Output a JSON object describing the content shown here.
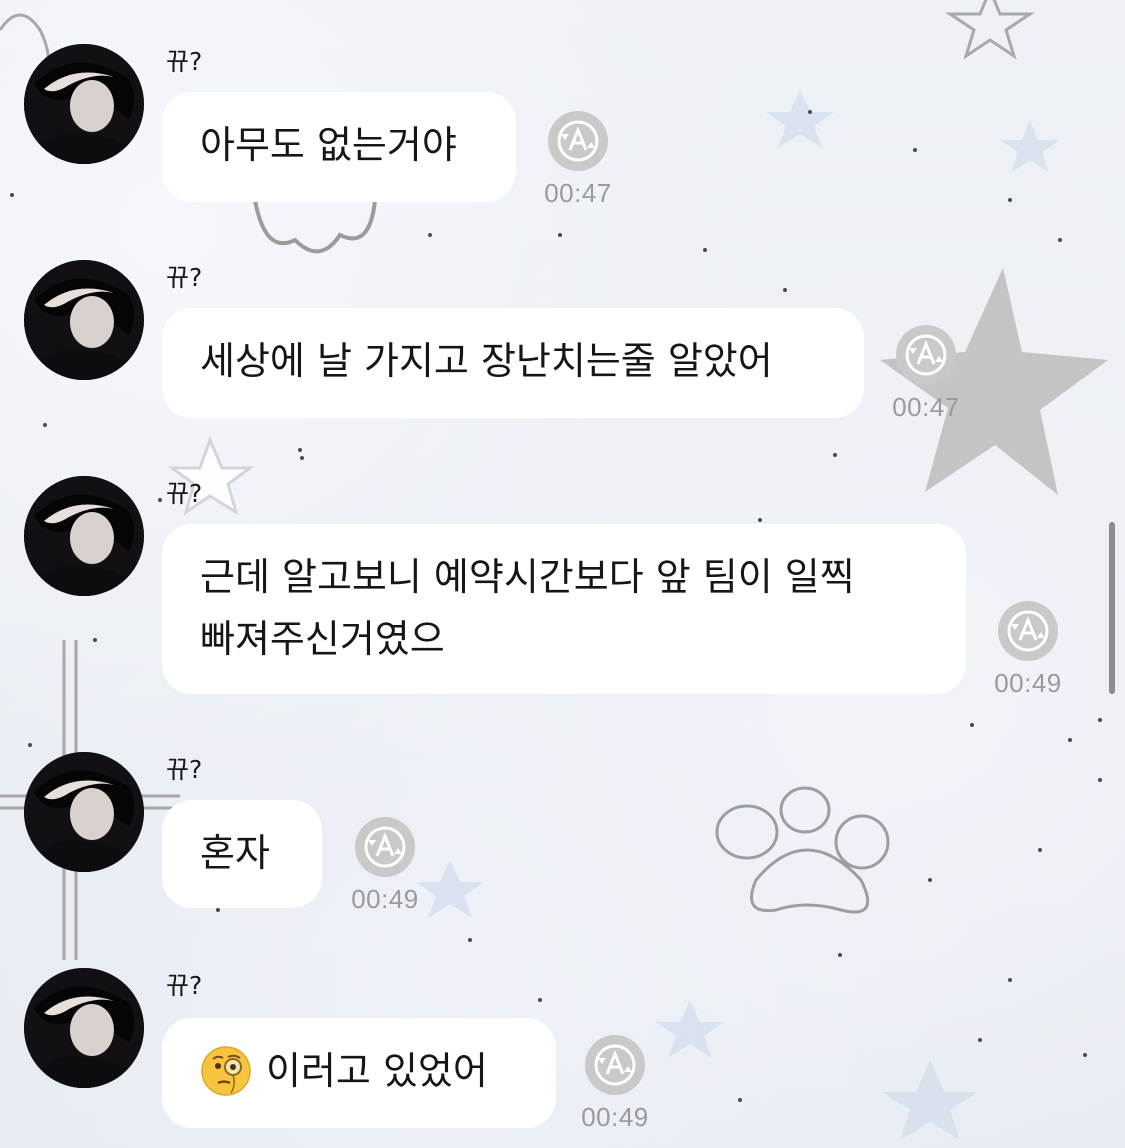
{
  "sender_name": "뀨?",
  "messages": [
    {
      "lines": [
        "아무도 없는거야"
      ],
      "time": "00:47",
      "icon": "translate-icon"
    },
    {
      "lines": [
        "세상에 날 가지고 장난치는줄 알았어"
      ],
      "time": "00:47",
      "icon": "translate-icon"
    },
    {
      "lines": [
        "근데 알고보니 예약시간보다 앞 팀이 일찍",
        "빠져주신거였으"
      ],
      "time": "00:49",
      "icon": "translate-icon"
    },
    {
      "lines": [
        "혼자"
      ],
      "time": "00:49",
      "icon": "translate-icon"
    },
    {
      "lines": [
        "이러고 있었어"
      ],
      "emoji": "face-with-monocle",
      "time": "00:49",
      "icon": "translate-icon"
    }
  ],
  "colors": {
    "bubble": "#ffffff",
    "time_text": "#9a9a9a",
    "translate_icon": "#c2c2c2",
    "background": "#e8edf3"
  }
}
